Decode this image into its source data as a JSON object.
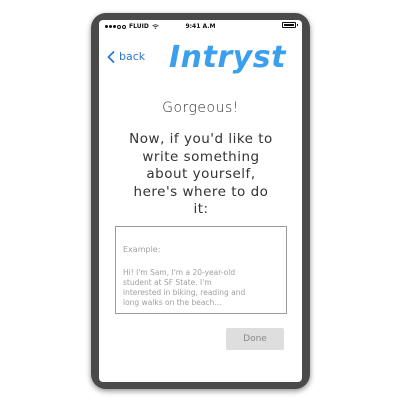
{
  "status_bar": {
    "carrier": "FLUID",
    "time": "9:41 A.M"
  },
  "nav": {
    "back_label": "back",
    "logo_text": "Intryst"
  },
  "content": {
    "heading": "Gorgeous!",
    "prompt_lines": [
      "Now, if you'd like to",
      "write something",
      "about yourself,",
      "here's where to do",
      "it:"
    ]
  },
  "bio_input": {
    "example_title": "Example:",
    "example_lines": [
      "Hi! I'm Sam, I'm a 20-year-old",
      "student at SF State. I'm",
      "interested in biking, reading and",
      "long walks on the beach..."
    ]
  },
  "actions": {
    "done_label": "Done"
  },
  "colors": {
    "accent": "#3aa0ee",
    "link": "#2a78d9",
    "device_frame": "#4a4a4a",
    "disabled_button": "#dedede"
  }
}
